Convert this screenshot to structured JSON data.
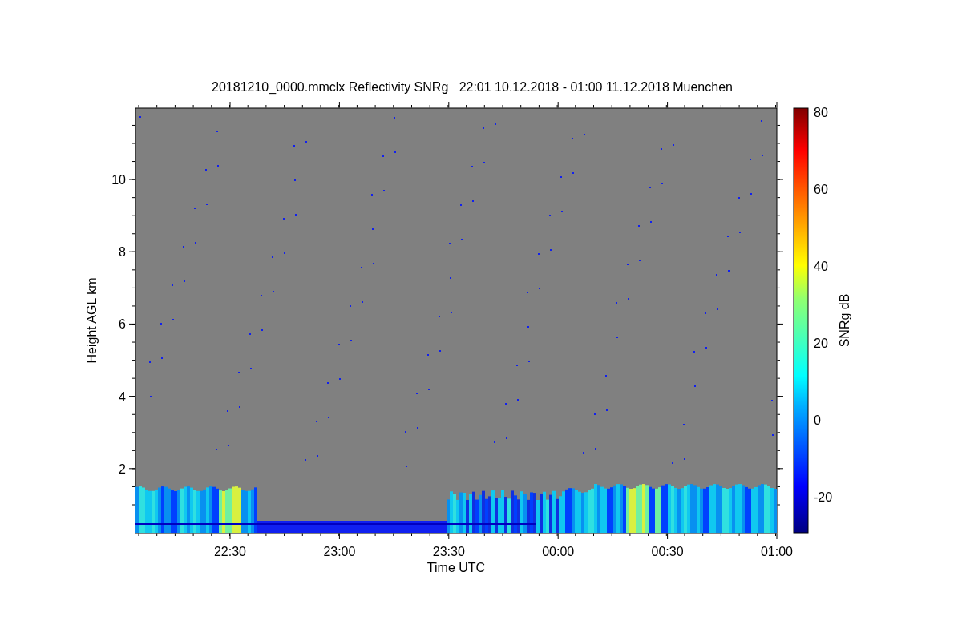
{
  "figure": {
    "title": "20181210_0000.mmclx Reflectivity SNRg   22:01 10.12.2018 - 01:00 11.12.2018 Muenchen",
    "xlabel": "Time UTC",
    "ylabel": "Height AGL km",
    "x_ticks": [
      "22:30",
      "23:00",
      "23:30",
      "00:00",
      "00:30",
      "01:00"
    ],
    "y_ticks": [
      "10",
      "8",
      "6",
      "4",
      "2"
    ],
    "colorbar": {
      "label": "SNRg dB",
      "ticks": [
        "80",
        "60",
        "40",
        "20",
        "0",
        "-20"
      ]
    }
  }
}
